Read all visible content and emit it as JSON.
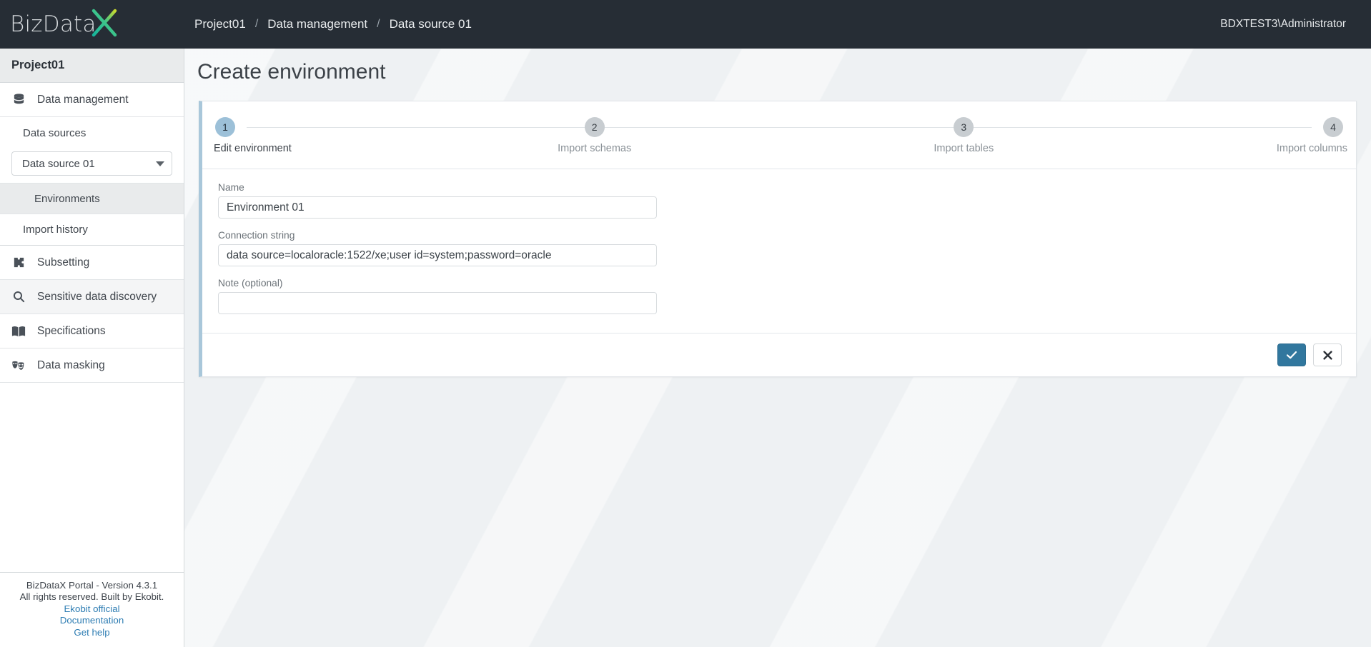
{
  "app": {
    "logo_text": "BizData",
    "logo_x": "X",
    "brand_colors": {
      "logo_gradient_start": "#17b49a",
      "logo_gradient_end": "#c8d92e",
      "accent": "#31779e",
      "topbar": "#262d35"
    }
  },
  "topbar": {
    "breadcrumb": [
      {
        "label": "Project01"
      },
      {
        "label": "Data management"
      },
      {
        "label": "Data source 01"
      }
    ],
    "separator": "/",
    "user": "BDXTEST3\\Administrator"
  },
  "sidebar": {
    "project": "Project01",
    "items": [
      {
        "label": "Data management",
        "icon": "database-icon"
      },
      {
        "label": "Subsetting",
        "icon": "puzzle-icon"
      },
      {
        "label": "Sensitive data discovery",
        "icon": "magnifier-icon"
      },
      {
        "label": "Specifications",
        "icon": "book-icon"
      },
      {
        "label": "Data masking",
        "icon": "masks-icon"
      }
    ],
    "data_sources_label": "Data sources",
    "data_source_select": {
      "value": "Data source 01",
      "caret": "chevron-down-icon"
    },
    "environments_label": "Environments",
    "import_history_label": "Import history",
    "footer": {
      "version": "BizDataX Portal - Version 4.3.1",
      "rights": "All rights reserved. Built by Ekobit.",
      "links": [
        {
          "label": "Ekobit official"
        },
        {
          "label": "Documentation"
        },
        {
          "label": "Get help"
        }
      ]
    }
  },
  "main": {
    "page_title": "Create environment",
    "stepper": {
      "steps": [
        {
          "number": "1",
          "label": "Edit environment",
          "state": "active"
        },
        {
          "number": "2",
          "label": "Import schemas",
          "state": "inactive"
        },
        {
          "number": "3",
          "label": "Import tables",
          "state": "inactive"
        },
        {
          "number": "4",
          "label": "Import columns",
          "state": "inactive"
        }
      ]
    },
    "form": {
      "name": {
        "label": "Name",
        "value": "Environment 01",
        "placeholder": ""
      },
      "connection_string": {
        "label": "Connection string",
        "value": "data source=localoracle:1522/xe;user id=system;password=oracle",
        "placeholder": ""
      },
      "note": {
        "label": "Note (optional)",
        "value": "",
        "placeholder": ""
      }
    },
    "actions": {
      "confirm": {
        "icon": "check-icon",
        "title": "Save"
      },
      "cancel": {
        "icon": "close-icon",
        "title": "Cancel"
      }
    }
  }
}
